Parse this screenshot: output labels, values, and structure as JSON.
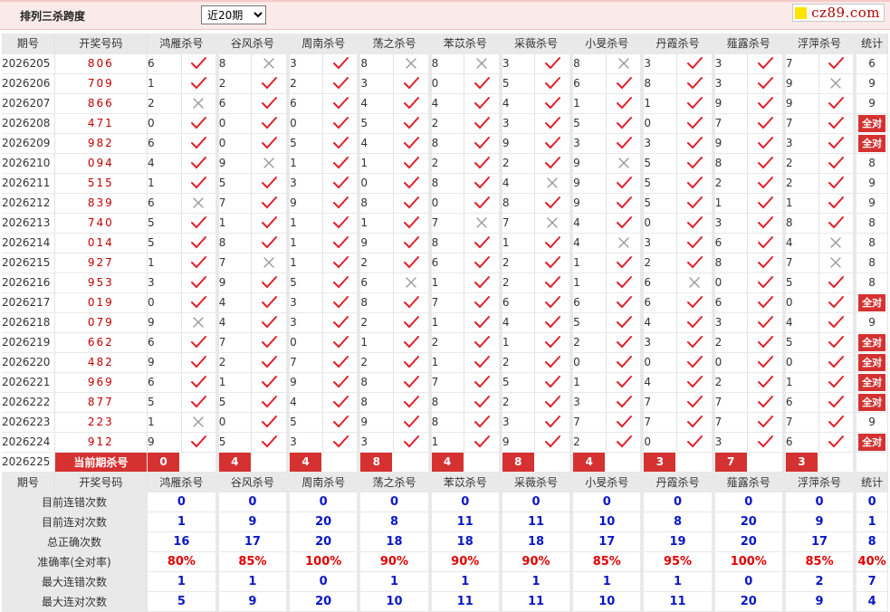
{
  "header": {
    "title": "排列三杀跨度",
    "period_select": "近20期",
    "logo_text": "cz89.com"
  },
  "colors": {
    "accent": "#d53131",
    "ok": "#e0202a",
    "wrong": "#9a9a9a",
    "stat_blue": "#0a17c7",
    "stat_red": "#e00000"
  },
  "columns": {
    "issue": "期号",
    "draw": "开奖号码",
    "total": "统计",
    "experts": [
      "鸿雁杀号",
      "谷风杀号",
      "周南杀号",
      "荡之杀号",
      "苯苡杀号",
      "采薇杀号",
      "小旻杀号",
      "丹霞杀号",
      "薤露杀号",
      "浮萍杀号"
    ]
  },
  "all_correct_label": "全对",
  "rows": [
    {
      "issue": "2026205",
      "draw": "806",
      "kills": [
        [
          "6",
          "ok"
        ],
        [
          "8",
          "x"
        ],
        [
          "3",
          "ok"
        ],
        [
          "8",
          "x"
        ],
        [
          "8",
          "x"
        ],
        [
          "3",
          "ok"
        ],
        [
          "8",
          "x"
        ],
        [
          "3",
          "ok"
        ],
        [
          "3",
          "ok"
        ],
        [
          "7",
          "ok"
        ]
      ],
      "total": "6"
    },
    {
      "issue": "2026206",
      "draw": "709",
      "kills": [
        [
          "1",
          "ok"
        ],
        [
          "2",
          "ok"
        ],
        [
          "2",
          "ok"
        ],
        [
          "3",
          "ok"
        ],
        [
          "0",
          "ok"
        ],
        [
          "5",
          "ok"
        ],
        [
          "6",
          "ok"
        ],
        [
          "8",
          "ok"
        ],
        [
          "3",
          "ok"
        ],
        [
          "9",
          "x"
        ]
      ],
      "total": "9"
    },
    {
      "issue": "2026207",
      "draw": "866",
      "kills": [
        [
          "2",
          "x"
        ],
        [
          "6",
          "ok"
        ],
        [
          "6",
          "ok"
        ],
        [
          "4",
          "ok"
        ],
        [
          "4",
          "ok"
        ],
        [
          "4",
          "ok"
        ],
        [
          "1",
          "ok"
        ],
        [
          "1",
          "ok"
        ],
        [
          "9",
          "ok"
        ],
        [
          "9",
          "ok"
        ]
      ],
      "total": "9"
    },
    {
      "issue": "2026208",
      "draw": "471",
      "kills": [
        [
          "0",
          "ok"
        ],
        [
          "0",
          "ok"
        ],
        [
          "0",
          "ok"
        ],
        [
          "5",
          "ok"
        ],
        [
          "2",
          "ok"
        ],
        [
          "3",
          "ok"
        ],
        [
          "5",
          "ok"
        ],
        [
          "0",
          "ok"
        ],
        [
          "7",
          "ok"
        ],
        [
          "7",
          "ok"
        ]
      ],
      "total": "全对"
    },
    {
      "issue": "2026209",
      "draw": "982",
      "kills": [
        [
          "6",
          "ok"
        ],
        [
          "0",
          "ok"
        ],
        [
          "5",
          "ok"
        ],
        [
          "4",
          "ok"
        ],
        [
          "8",
          "ok"
        ],
        [
          "9",
          "ok"
        ],
        [
          "3",
          "ok"
        ],
        [
          "3",
          "ok"
        ],
        [
          "9",
          "ok"
        ],
        [
          "3",
          "ok"
        ]
      ],
      "total": "全对"
    },
    {
      "issue": "2026210",
      "draw": "094",
      "kills": [
        [
          "4",
          "ok"
        ],
        [
          "9",
          "x"
        ],
        [
          "1",
          "ok"
        ],
        [
          "1",
          "ok"
        ],
        [
          "2",
          "ok"
        ],
        [
          "2",
          "ok"
        ],
        [
          "9",
          "x"
        ],
        [
          "5",
          "ok"
        ],
        [
          "8",
          "ok"
        ],
        [
          "2",
          "ok"
        ]
      ],
      "total": "8"
    },
    {
      "issue": "2026211",
      "draw": "515",
      "kills": [
        [
          "1",
          "ok"
        ],
        [
          "5",
          "ok"
        ],
        [
          "3",
          "ok"
        ],
        [
          "0",
          "ok"
        ],
        [
          "8",
          "ok"
        ],
        [
          "4",
          "x"
        ],
        [
          "9",
          "ok"
        ],
        [
          "5",
          "ok"
        ],
        [
          "2",
          "ok"
        ],
        [
          "2",
          "ok"
        ]
      ],
      "total": "9"
    },
    {
      "issue": "2026212",
      "draw": "839",
      "kills": [
        [
          "6",
          "x"
        ],
        [
          "7",
          "ok"
        ],
        [
          "9",
          "ok"
        ],
        [
          "8",
          "ok"
        ],
        [
          "0",
          "ok"
        ],
        [
          "8",
          "ok"
        ],
        [
          "9",
          "ok"
        ],
        [
          "5",
          "ok"
        ],
        [
          "1",
          "ok"
        ],
        [
          "1",
          "ok"
        ]
      ],
      "total": "9"
    },
    {
      "issue": "2026213",
      "draw": "740",
      "kills": [
        [
          "5",
          "ok"
        ],
        [
          "1",
          "ok"
        ],
        [
          "1",
          "ok"
        ],
        [
          "1",
          "ok"
        ],
        [
          "7",
          "x"
        ],
        [
          "7",
          "x"
        ],
        [
          "4",
          "ok"
        ],
        [
          "0",
          "ok"
        ],
        [
          "3",
          "ok"
        ],
        [
          "8",
          "ok"
        ]
      ],
      "total": "8"
    },
    {
      "issue": "2026214",
      "draw": "014",
      "kills": [
        [
          "5",
          "ok"
        ],
        [
          "8",
          "ok"
        ],
        [
          "1",
          "ok"
        ],
        [
          "9",
          "ok"
        ],
        [
          "8",
          "ok"
        ],
        [
          "1",
          "ok"
        ],
        [
          "4",
          "x"
        ],
        [
          "3",
          "ok"
        ],
        [
          "6",
          "ok"
        ],
        [
          "4",
          "x"
        ]
      ],
      "total": "8"
    },
    {
      "issue": "2026215",
      "draw": "927",
      "kills": [
        [
          "1",
          "ok"
        ],
        [
          "7",
          "x"
        ],
        [
          "1",
          "ok"
        ],
        [
          "2",
          "ok"
        ],
        [
          "6",
          "ok"
        ],
        [
          "2",
          "ok"
        ],
        [
          "1",
          "ok"
        ],
        [
          "2",
          "ok"
        ],
        [
          "8",
          "ok"
        ],
        [
          "7",
          "x"
        ]
      ],
      "total": "8"
    },
    {
      "issue": "2026216",
      "draw": "953",
      "kills": [
        [
          "3",
          "ok"
        ],
        [
          "9",
          "ok"
        ],
        [
          "5",
          "ok"
        ],
        [
          "6",
          "x"
        ],
        [
          "1",
          "ok"
        ],
        [
          "2",
          "ok"
        ],
        [
          "1",
          "ok"
        ],
        [
          "6",
          "x"
        ],
        [
          "0",
          "ok"
        ],
        [
          "5",
          "ok"
        ]
      ],
      "total": "8"
    },
    {
      "issue": "2026217",
      "draw": "019",
      "kills": [
        [
          "0",
          "ok"
        ],
        [
          "4",
          "ok"
        ],
        [
          "3",
          "ok"
        ],
        [
          "8",
          "ok"
        ],
        [
          "7",
          "ok"
        ],
        [
          "6",
          "ok"
        ],
        [
          "6",
          "ok"
        ],
        [
          "6",
          "ok"
        ],
        [
          "6",
          "ok"
        ],
        [
          "0",
          "ok"
        ]
      ],
      "total": "全对"
    },
    {
      "issue": "2026218",
      "draw": "079",
      "kills": [
        [
          "9",
          "x"
        ],
        [
          "4",
          "ok"
        ],
        [
          "3",
          "ok"
        ],
        [
          "2",
          "ok"
        ],
        [
          "1",
          "ok"
        ],
        [
          "4",
          "ok"
        ],
        [
          "5",
          "ok"
        ],
        [
          "4",
          "ok"
        ],
        [
          "3",
          "ok"
        ],
        [
          "4",
          "ok"
        ]
      ],
      "total": "9"
    },
    {
      "issue": "2026219",
      "draw": "662",
      "kills": [
        [
          "6",
          "ok"
        ],
        [
          "7",
          "ok"
        ],
        [
          "0",
          "ok"
        ],
        [
          "1",
          "ok"
        ],
        [
          "2",
          "ok"
        ],
        [
          "1",
          "ok"
        ],
        [
          "2",
          "ok"
        ],
        [
          "3",
          "ok"
        ],
        [
          "2",
          "ok"
        ],
        [
          "5",
          "ok"
        ]
      ],
      "total": "全对"
    },
    {
      "issue": "2026220",
      "draw": "482",
      "kills": [
        [
          "9",
          "ok"
        ],
        [
          "2",
          "ok"
        ],
        [
          "7",
          "ok"
        ],
        [
          "2",
          "ok"
        ],
        [
          "1",
          "ok"
        ],
        [
          "2",
          "ok"
        ],
        [
          "0",
          "ok"
        ],
        [
          "0",
          "ok"
        ],
        [
          "0",
          "ok"
        ],
        [
          "0",
          "ok"
        ]
      ],
      "total": "全对"
    },
    {
      "issue": "2026221",
      "draw": "969",
      "kills": [
        [
          "6",
          "ok"
        ],
        [
          "1",
          "ok"
        ],
        [
          "9",
          "ok"
        ],
        [
          "8",
          "ok"
        ],
        [
          "7",
          "ok"
        ],
        [
          "5",
          "ok"
        ],
        [
          "1",
          "ok"
        ],
        [
          "4",
          "ok"
        ],
        [
          "2",
          "ok"
        ],
        [
          "1",
          "ok"
        ]
      ],
      "total": "全对"
    },
    {
      "issue": "2026222",
      "draw": "877",
      "kills": [
        [
          "5",
          "ok"
        ],
        [
          "5",
          "ok"
        ],
        [
          "4",
          "ok"
        ],
        [
          "8",
          "ok"
        ],
        [
          "8",
          "ok"
        ],
        [
          "2",
          "ok"
        ],
        [
          "3",
          "ok"
        ],
        [
          "7",
          "ok"
        ],
        [
          "7",
          "ok"
        ],
        [
          "6",
          "ok"
        ]
      ],
      "total": "全对"
    },
    {
      "issue": "2026223",
      "draw": "223",
      "kills": [
        [
          "1",
          "x"
        ],
        [
          "0",
          "ok"
        ],
        [
          "5",
          "ok"
        ],
        [
          "9",
          "ok"
        ],
        [
          "8",
          "ok"
        ],
        [
          "3",
          "ok"
        ],
        [
          "7",
          "ok"
        ],
        [
          "7",
          "ok"
        ],
        [
          "7",
          "ok"
        ],
        [
          "7",
          "ok"
        ]
      ],
      "total": "9"
    },
    {
      "issue": "2026224",
      "draw": "912",
      "kills": [
        [
          "9",
          "ok"
        ],
        [
          "5",
          "ok"
        ],
        [
          "3",
          "ok"
        ],
        [
          "3",
          "ok"
        ],
        [
          "1",
          "ok"
        ],
        [
          "9",
          "ok"
        ],
        [
          "2",
          "ok"
        ],
        [
          "0",
          "ok"
        ],
        [
          "3",
          "ok"
        ],
        [
          "6",
          "ok"
        ]
      ],
      "total": "全对"
    }
  ],
  "current": {
    "issue": "2026225",
    "label": "当前期杀号",
    "kills": [
      "0",
      "4",
      "4",
      "8",
      "4",
      "8",
      "4",
      "3",
      "7",
      "3"
    ]
  },
  "stats": [
    {
      "label": "目前连错次数",
      "values": [
        "0",
        "0",
        "0",
        "0",
        "0",
        "0",
        "0",
        "0",
        "0",
        "0"
      ],
      "total": "0",
      "style": "blue"
    },
    {
      "label": "目前连对次数",
      "values": [
        "1",
        "9",
        "20",
        "8",
        "11",
        "11",
        "10",
        "8",
        "20",
        "9"
      ],
      "total": "1",
      "style": "blue"
    },
    {
      "label": "总正确次数",
      "values": [
        "16",
        "17",
        "20",
        "18",
        "18",
        "18",
        "17",
        "19",
        "20",
        "17"
      ],
      "total": "8",
      "style": "blue"
    },
    {
      "label": "准确率(全对率)",
      "values": [
        "80%",
        "85%",
        "100%",
        "90%",
        "90%",
        "90%",
        "85%",
        "95%",
        "100%",
        "85%"
      ],
      "total": "40%",
      "style": "red"
    },
    {
      "label": "最大连错次数",
      "values": [
        "1",
        "1",
        "0",
        "1",
        "1",
        "1",
        "1",
        "1",
        "0",
        "2"
      ],
      "total": "7",
      "style": "blue"
    },
    {
      "label": "最大连对次数",
      "values": [
        "5",
        "9",
        "20",
        "10",
        "11",
        "11",
        "10",
        "11",
        "20",
        "9"
      ],
      "total": "4",
      "style": "blue"
    }
  ]
}
